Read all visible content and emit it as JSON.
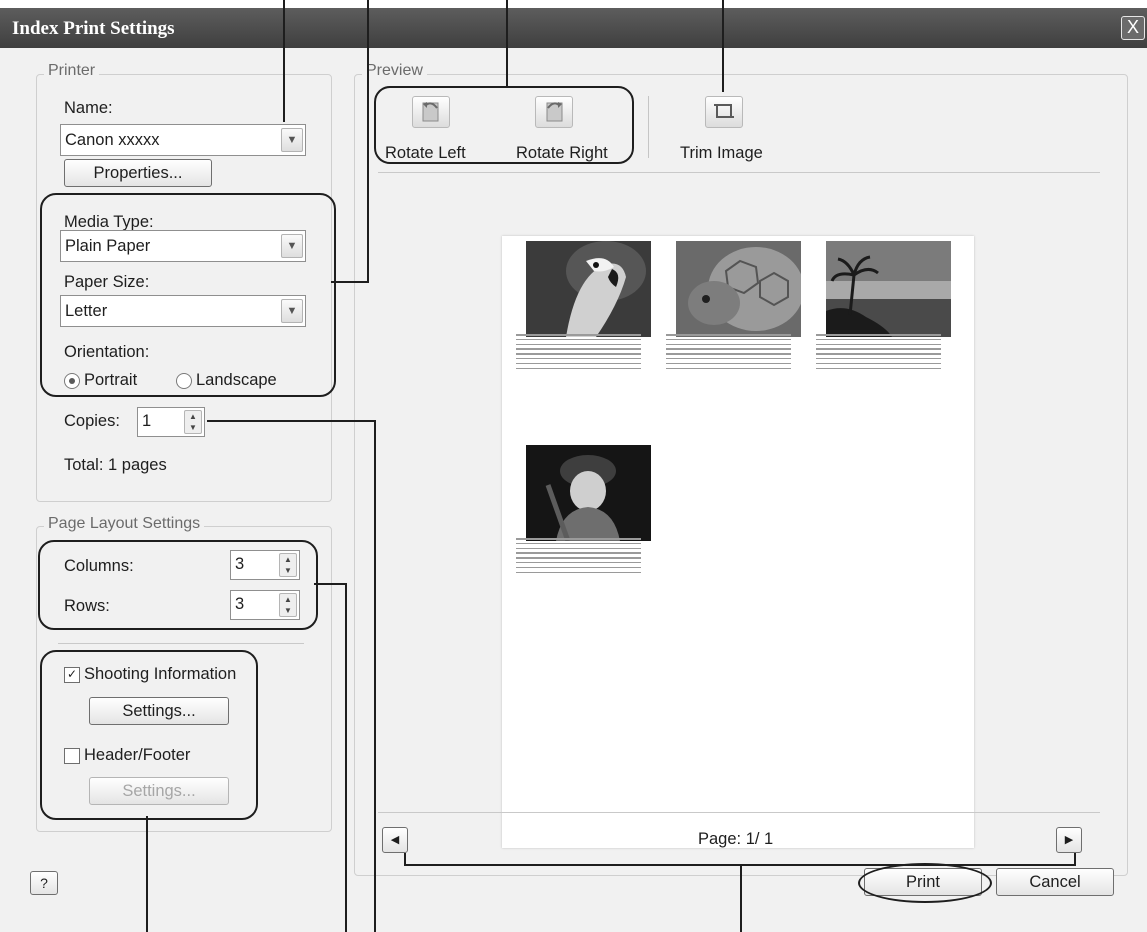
{
  "window": {
    "title": "Index Print Settings",
    "close_label": "X"
  },
  "printer": {
    "legend": "Printer",
    "name_label": "Name:",
    "name_value": "Canon xxxxx",
    "properties_button": "Properties...",
    "media_type_label": "Media Type:",
    "media_type_value": "Plain Paper",
    "paper_size_label": "Paper Size:",
    "paper_size_value": "Letter",
    "orientation_label": "Orientation:",
    "orientation_options": [
      "Portrait",
      "Landscape"
    ],
    "orientation_selected": "Portrait",
    "copies_label": "Copies:",
    "copies_value": "1",
    "total_text": "Total: 1 pages"
  },
  "page_layout": {
    "legend": "Page Layout Settings",
    "columns_label": "Columns:",
    "columns_value": "3",
    "rows_label": "Rows:",
    "rows_value": "3",
    "shooting_info_label": "Shooting Information",
    "shooting_info_checked": true,
    "shooting_settings_button": "Settings...",
    "header_footer_label": "Header/Footer",
    "header_footer_checked": false,
    "header_footer_settings_button": "Settings..."
  },
  "preview": {
    "legend": "Preview",
    "toolbar": [
      "Rotate Left",
      "Rotate Right",
      "Trim Image"
    ],
    "thumbnails": [
      "parrot-photo",
      "tortoise-photo",
      "seascape-palm-photo",
      "child-portrait-photo"
    ],
    "page_indicator": "Page: 1/ 1"
  },
  "footer": {
    "help_button": "?",
    "print_button": "Print",
    "cancel_button": "Cancel"
  },
  "icons": [
    "dropdown-arrow-icon",
    "spin-arrows-icon",
    "rotate-left-icon",
    "rotate-right-icon",
    "trim-image-icon",
    "prev-page-icon",
    "next-page-icon",
    "close-icon"
  ],
  "colors": {
    "title_bar": "#4a4a4a",
    "dialog_bg": "#f1f1f1",
    "callout": "#1e1e1e"
  }
}
